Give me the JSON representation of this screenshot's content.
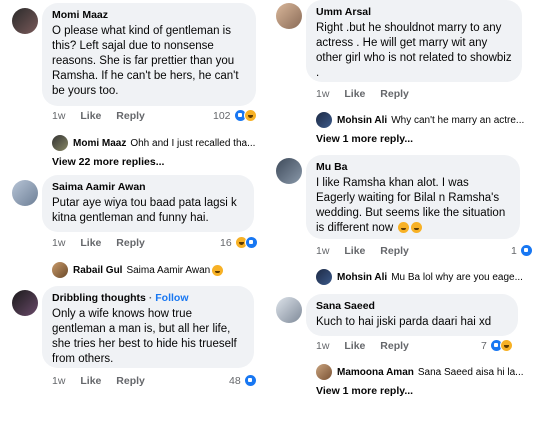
{
  "comments_left": [
    {
      "author": "Momi Maaz",
      "text": "O please what kind of gentleman is this? Left sajal due to nonsense reasons. She is far prettier than you Ramsha. If he can't be hers, he can't be yours too.",
      "time": "1w",
      "like": "Like",
      "reply": "Reply",
      "reactions": "102",
      "reply_preview": {
        "name": "Momi Maaz",
        "text": "Ohh and I just recalled tha..."
      },
      "more": "View 22 more replies..."
    },
    {
      "author": "Saima Aamir Awan",
      "text": "Putar aye wiya tou baad pata lagsi k kitna gentleman and funny hai.",
      "time": "1w",
      "like": "Like",
      "reply": "Reply",
      "reactions": "16",
      "reply_preview": {
        "name": "Rabail Gul",
        "text": "Saima Aamir Awan"
      }
    },
    {
      "author": "Dribbling thoughts",
      "follow": "Follow",
      "text": "Only a wife knows how true gentleman a man is, but all her life, she tries her best to hide his trueself from others.",
      "time": "1w",
      "like": "Like",
      "reply": "Reply",
      "reactions": "48"
    }
  ],
  "comments_right": [
    {
      "author": "Umm Arsal",
      "text": "Right .but he shouldnot marry to any actress . He will get marry wit any other girl who is not related to showbiz .",
      "time": "1w",
      "like": "Like",
      "reply": "Reply",
      "reply_preview": {
        "name": "Mohsin Ali",
        "text": "Why can't he marry an actre..."
      },
      "more": "View 1 more reply..."
    },
    {
      "author": "Mu Ba",
      "text": "I like Ramsha khan alot. I was Eagerly waiting for Bilal n Ramsha's wedding.  But seems like  the situation is different now",
      "time": "1w",
      "like": "Like",
      "reply": "Reply",
      "reactions": "1",
      "reply_preview": {
        "name": "Mohsin Ali",
        "text": "Mu Ba lol why are you eage..."
      }
    },
    {
      "author": "Sana Saeed",
      "text": "Kuch to hai jiski parda daari hai xd",
      "time": "1w",
      "like": "Like",
      "reply": "Reply",
      "reactions": "7",
      "reply_preview": {
        "name": "Mamoona Aman",
        "text": "Sana Saeed aisa hi la..."
      },
      "more": "View 1 more reply..."
    }
  ],
  "colors": {
    "bubble": "#f0f2f5",
    "link": "#1877f2",
    "meta": "#65676b"
  }
}
